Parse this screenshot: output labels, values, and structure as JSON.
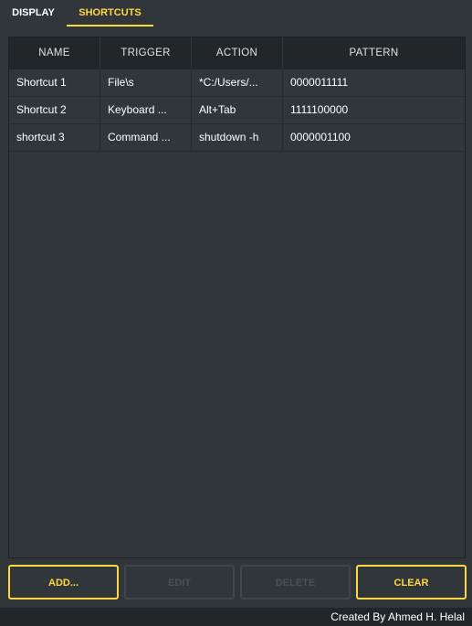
{
  "tabs": [
    {
      "label": "DISPLAY",
      "active": false
    },
    {
      "label": "SHORTCUTS",
      "active": true
    }
  ],
  "table": {
    "columns": [
      "NAME",
      "TRIGGER",
      "ACTION",
      "PATTERN"
    ],
    "rows": [
      {
        "name": "Shortcut 1",
        "trigger": "File\\s",
        "action": "*C:/Users/...",
        "pattern": "0000011111"
      },
      {
        "name": "Shortcut 2",
        "trigger": "Keyboard ...",
        "action": "Alt+Tab",
        "pattern": "1111100000"
      },
      {
        "name": "shortcut 3",
        "trigger": "Command ...",
        "action": "shutdown -h",
        "pattern": "0000001100"
      }
    ]
  },
  "buttons": {
    "add": {
      "label": "ADD...",
      "enabled": true
    },
    "edit": {
      "label": "EDIT",
      "enabled": false
    },
    "delete": {
      "label": "DELETE",
      "enabled": false
    },
    "clear": {
      "label": "CLEAR",
      "enabled": true
    }
  },
  "footer": {
    "credit": "Created By Ahmed H. Helal"
  },
  "colors": {
    "accent": "#ffd740",
    "background": "#31363b",
    "header_background": "#232629",
    "disabled": "#4b5057"
  }
}
